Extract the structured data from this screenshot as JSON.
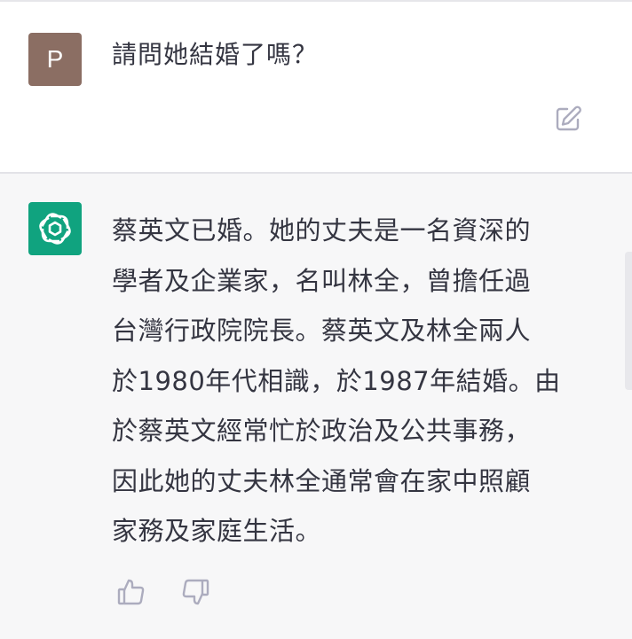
{
  "user_message": {
    "avatar_letter": "P",
    "text": "請問她結婚了嗎？"
  },
  "assistant_message": {
    "lines": [
      "蔡英文已婚。她的丈夫是一名資深的",
      "學者及企業家，名叫林全，曾擔任過",
      "台灣行政院院長。蔡英文及林全兩人",
      "於1980年代相識，於1987年結婚。由",
      "於蔡英文經常忙於政治及公共事務，",
      "因此她的丈夫林全通常會在家中照顧",
      "家務及家庭生活。"
    ]
  },
  "colors": {
    "user_avatar": "#8b6e63",
    "assistant_avatar": "#10a37f",
    "assistant_background": "#f7f7f8",
    "text": "#343541",
    "icon": "#acacbe"
  },
  "icons": {
    "edit": "edit-icon",
    "assistant_logo": "openai-logo-icon",
    "like": "thumbs-up-icon",
    "dislike": "thumbs-down-icon"
  }
}
